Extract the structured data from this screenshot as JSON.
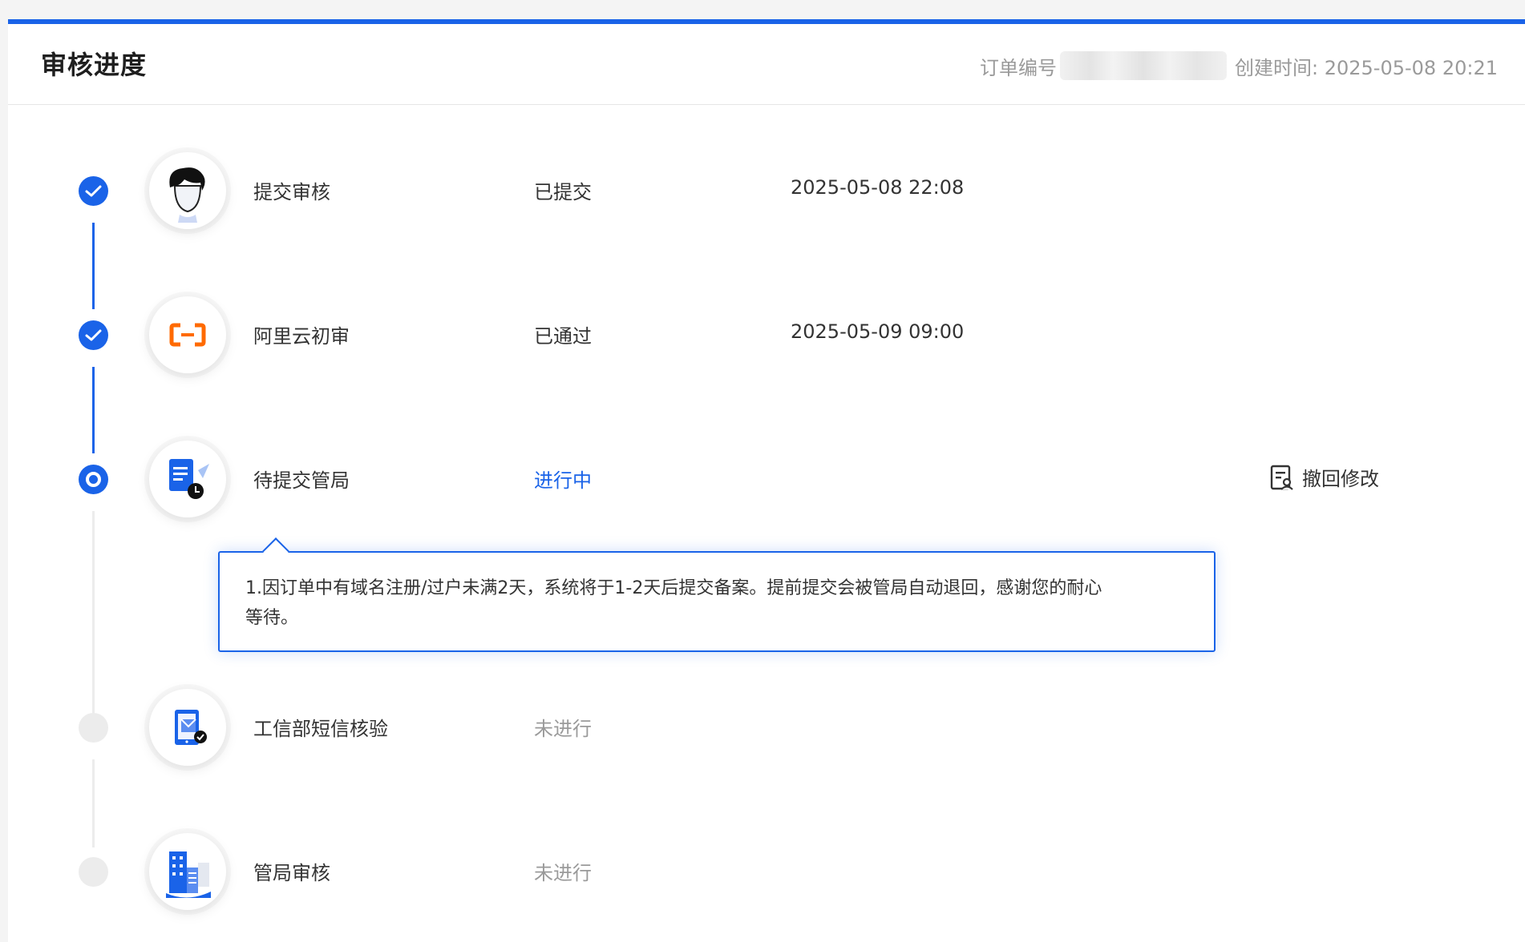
{
  "header": {
    "title": "审核进度",
    "order_label": "订单编号",
    "created_label": "创建时间: 2025-05-08 20:21"
  },
  "steps": [
    {
      "name": "提交审核",
      "status": "已提交",
      "time": "2025-05-08 22:08",
      "state": "done",
      "icon": "user-avatar-icon"
    },
    {
      "name": "阿里云初审",
      "status": "已通过",
      "time": "2025-05-09 09:00",
      "state": "done",
      "icon": "aliyun-logo-icon"
    },
    {
      "name": "待提交管局",
      "status": "进行中",
      "time": "",
      "state": "active",
      "icon": "document-clock-icon"
    },
    {
      "name": "工信部短信核验",
      "status": "未进行",
      "time": "",
      "state": "todo",
      "icon": "phone-sms-icon"
    },
    {
      "name": "管局审核",
      "status": "未进行",
      "time": "",
      "state": "todo",
      "icon": "building-icon"
    }
  ],
  "actions": {
    "withdraw_label": "撤回修改"
  },
  "notice": {
    "line1": "1.因订单中有域名注册/过户未满2天，系统将于1-2天后提交备案。提前提交会被管局自动退回，感谢您的耐心",
    "line2": "等待。"
  },
  "colors": {
    "accent": "#1a63e8",
    "aliyun_orange": "#ff6a00",
    "muted": "#9a9a9a"
  }
}
